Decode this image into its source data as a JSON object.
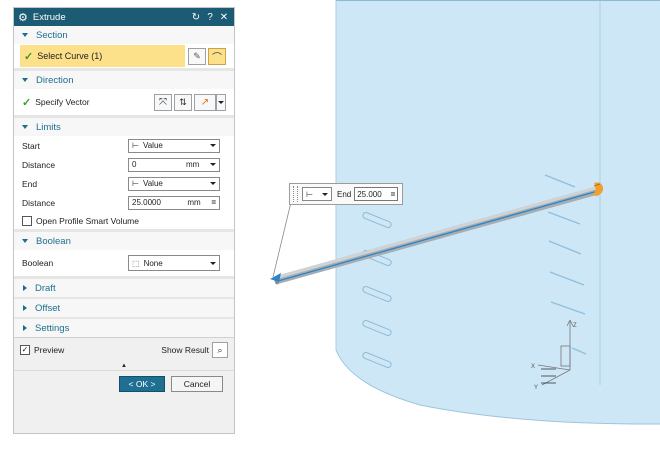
{
  "dialog": {
    "title": "Extrude",
    "title_icon": "gear-icon",
    "title_buttons": [
      "reset-icon",
      "help-icon",
      "close-icon"
    ],
    "help_glyph": "?",
    "close_glyph": "✕",
    "reset_glyph": "↻"
  },
  "section": {
    "label": "Section",
    "select_curve": "Select Curve (1)"
  },
  "direction": {
    "label": "Direction",
    "specify_vector": "Specify Vector"
  },
  "limits": {
    "label": "Limits",
    "start_label": "Start",
    "start_value": "Value",
    "distance1_label": "Distance",
    "distance1_value": "0",
    "distance1_unit": "mm",
    "end_label": "End",
    "end_value": "Value",
    "distance2_label": "Distance",
    "distance2_value": "25.0000",
    "distance2_unit": "mm",
    "open_profile": "Open Profile Smart Volume",
    "open_profile_checked": false
  },
  "boolean": {
    "label": "Boolean",
    "field_label": "Boolean",
    "value": "None"
  },
  "collapsed_sections": {
    "draft": "Draft",
    "offset": "Offset",
    "settings": "Settings"
  },
  "footer": {
    "preview_label": "Preview",
    "preview_checked": true,
    "show_result_label": "Show Result",
    "ok_label": "< OK >",
    "cancel_label": "Cancel",
    "expand_glyph": "▲"
  },
  "float_tip": {
    "end_label": "End",
    "end_value": "25.000",
    "equals_glyph": "="
  },
  "colors": {
    "title_bg": "#1c5b74",
    "accent": "#1c6e8f",
    "select_highlight": "#fce08a",
    "ok_button": "#1f6f93",
    "model_body": "#cfe9f8",
    "model_edge": "#8fb9d3",
    "rod": "#9aa0a6",
    "rod_highlight": "#2a86c9",
    "handle": "#f0a030"
  }
}
